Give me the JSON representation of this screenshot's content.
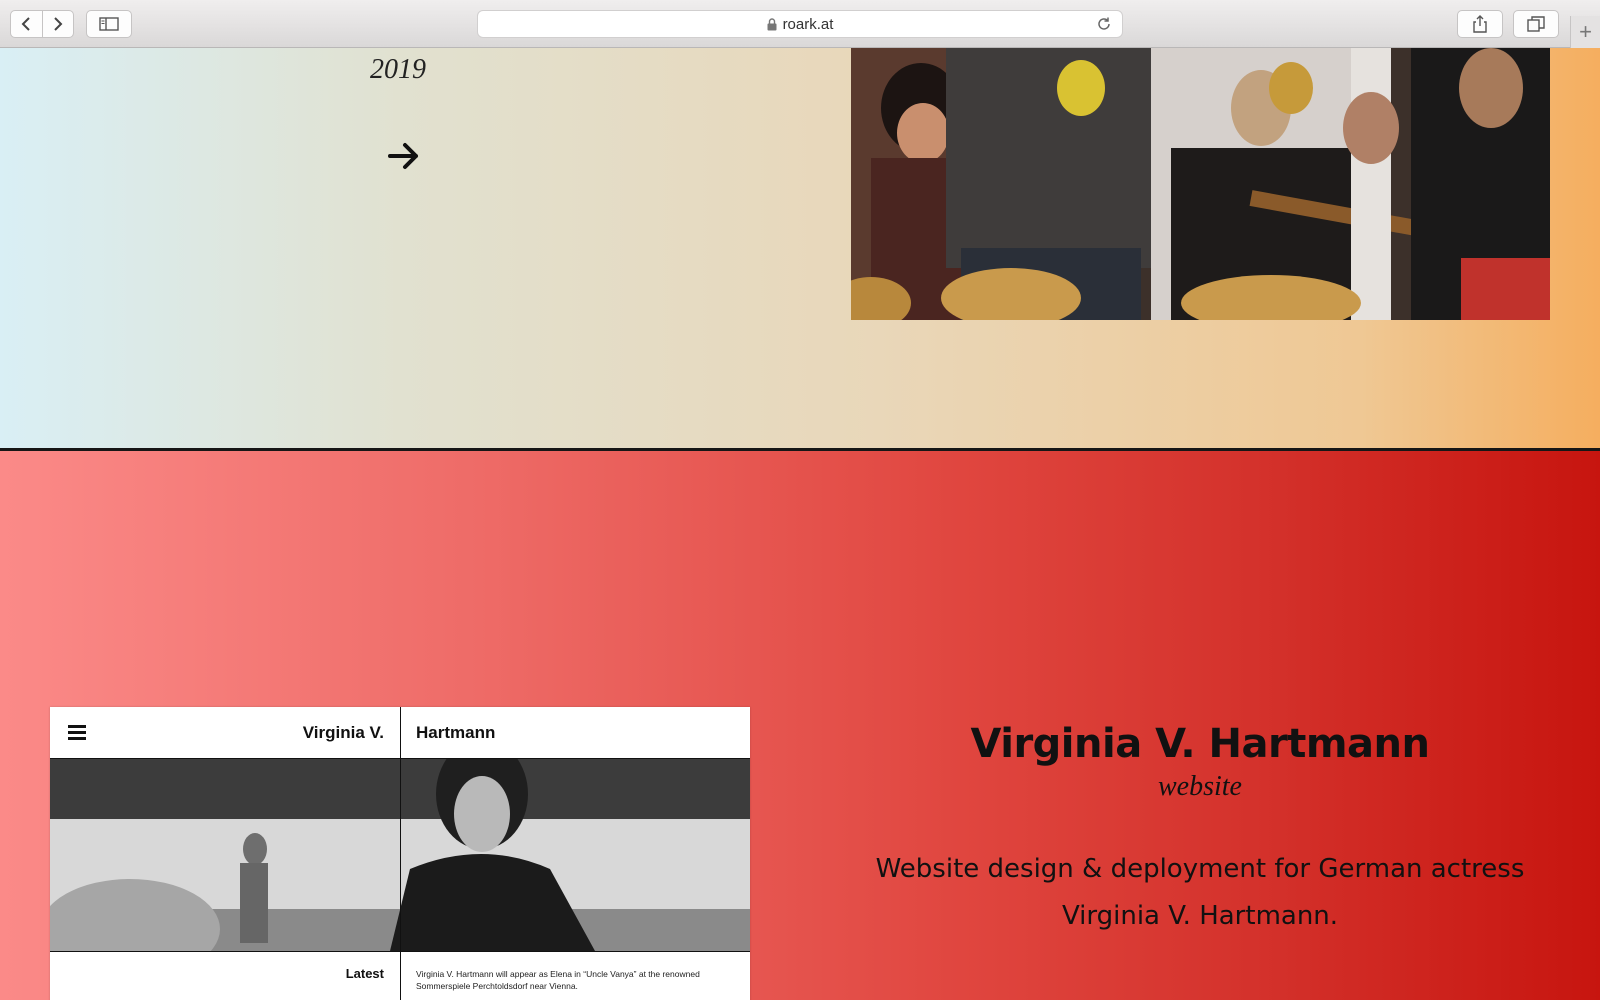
{
  "browser": {
    "url": "roark.at",
    "icons": [
      "chevron-left-icon",
      "chevron-right-icon",
      "sidebar-icon",
      "lock-icon",
      "reload-icon",
      "share-icon",
      "tabs-icon",
      "plus-icon"
    ]
  },
  "section1": {
    "year": "2019",
    "arrow_icon": "arrow-right-icon",
    "photo_alt": "orchestra-musicians-photo",
    "gradient": [
      "#d9eff5",
      "#f5ae5f"
    ]
  },
  "section2": {
    "gradient": [
      "#fb8a88",
      "#c7150f"
    ],
    "mockup": {
      "first_name": "Virginia V.",
      "last_name": "Hartmann",
      "latest_label": "Latest",
      "news_text": "Virginia V. Hartmann will appear as Elena in “Uncle Vanya” at the renowned Sommerspiele Perchtoldsdorf near Vienna."
    },
    "title": "Virginia V. Hartmann",
    "subtitle": "website",
    "description": "Website design & deployment for German actress Virginia V. Hartmann."
  }
}
